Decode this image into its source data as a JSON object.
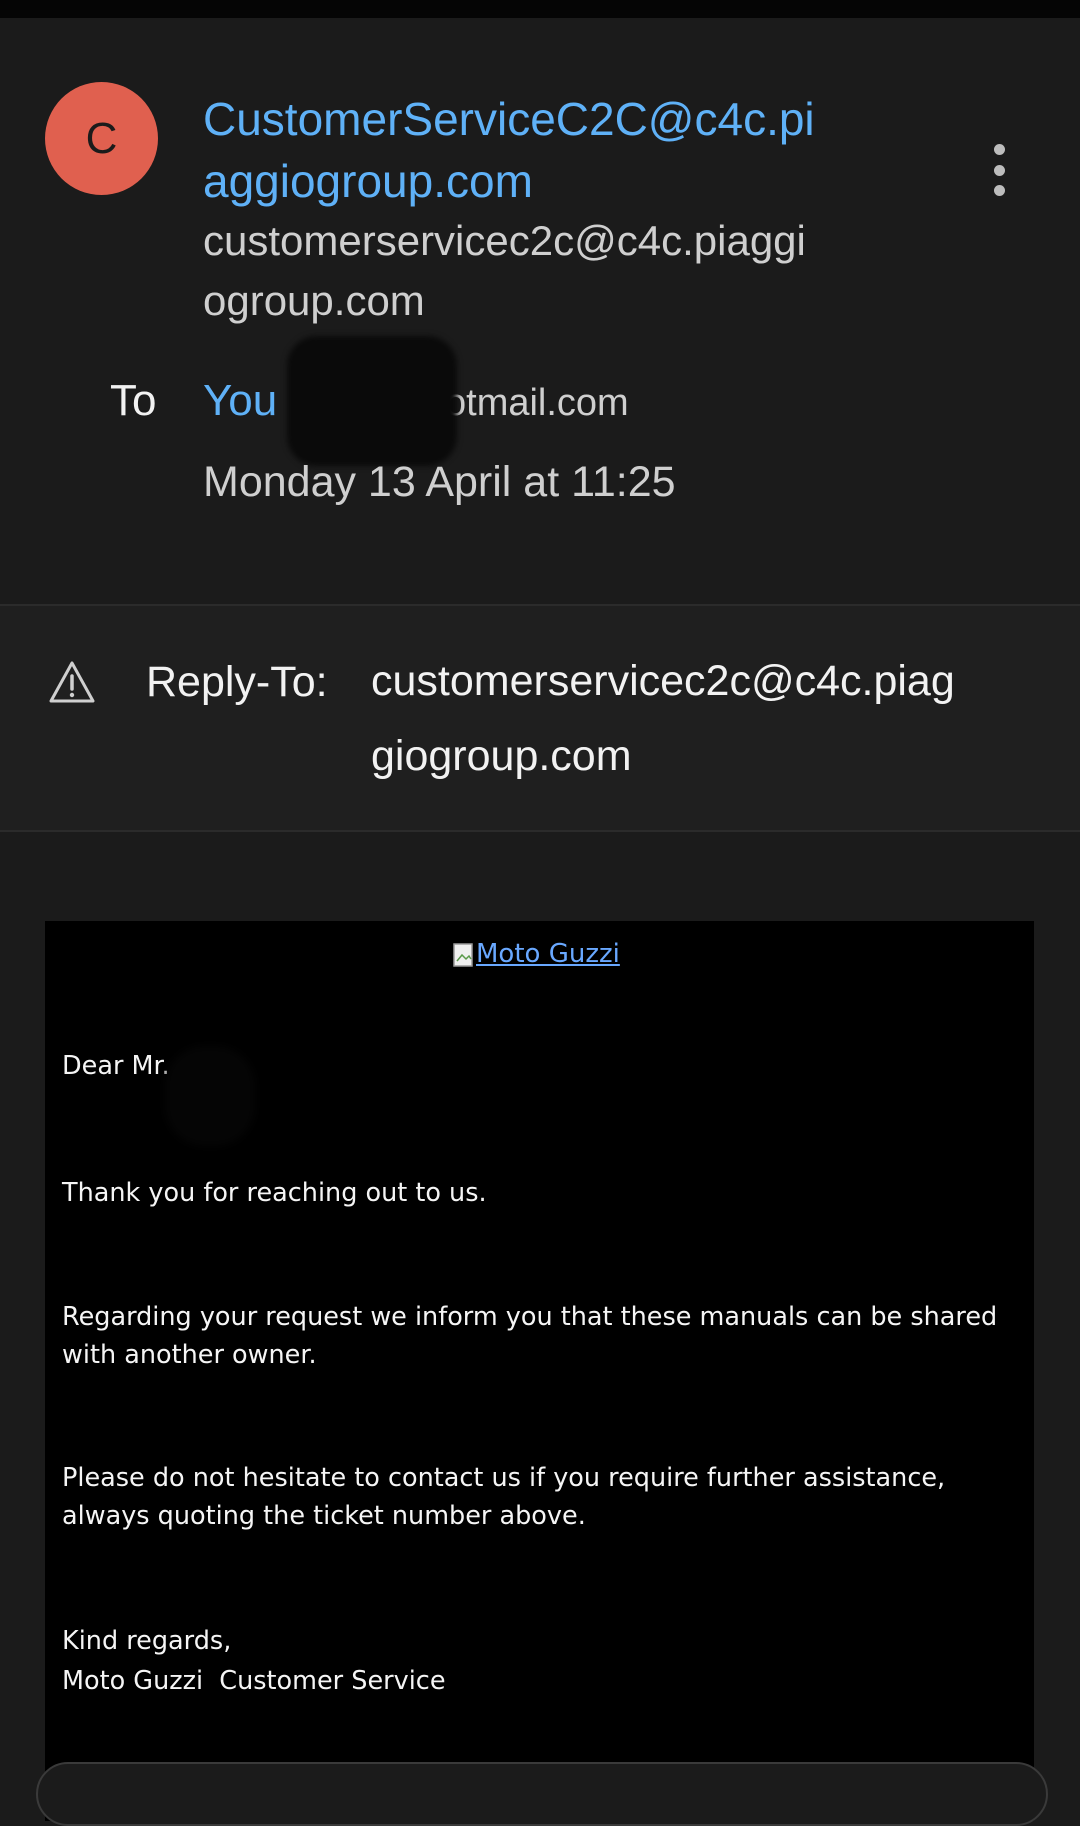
{
  "sender": {
    "avatar_letter": "C",
    "avatar_color": "#e0604f",
    "name": "CustomerServiceC2C@c4c.piaggiogroup.com",
    "email": "customerservicec2c@c4c.piaggiogroup.com",
    "name_color": "#5fb1f7"
  },
  "menu": {
    "icon": "more-vert-icon"
  },
  "recipients": {
    "to_label": "To",
    "you_label": "You",
    "email_partial": "otmail.com"
  },
  "date": "Monday 13 April at 11:25",
  "reply_to": {
    "icon": "warning-triangle-icon",
    "label": "Reply-To:",
    "address": "customerservicec2c@c4c.piaggiogroup.com"
  },
  "message": {
    "logo_alt": "Moto Guzzi",
    "greeting": "Dear Mr.",
    "p1": "Thank you for reaching out to us.",
    "p2": "Regarding your request we inform you that these manuals can be shared with another owner.",
    "p3": "Please do not hesitate to contact us if you require further assistance, always quoting the ticket number above.",
    "closing": "Kind regards,",
    "signature": "Moto Guzzi  Customer Service"
  }
}
